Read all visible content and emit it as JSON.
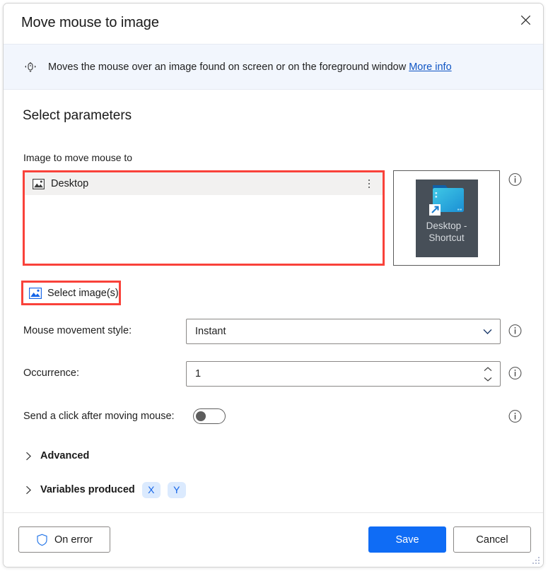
{
  "window": {
    "title": "Move mouse to image",
    "close_icon": "close-icon"
  },
  "banner": {
    "icon": "move-mouse-icon",
    "text": "Moves the mouse over an image found on screen or on the foreground window",
    "link_label": "More info"
  },
  "main": {
    "section_title": "Select parameters",
    "image_field_label": "Image to move mouse to",
    "image_list": {
      "items": [
        {
          "icon": "picture-icon",
          "label": "Desktop",
          "menu_icon": "more-vertical-icon"
        }
      ]
    },
    "preview": {
      "thumbnail_label_line1": "Desktop -",
      "thumbnail_label_line2": "Shortcut",
      "folder_icon": "folder-shortcut-icon",
      "info_icon": "info-icon"
    },
    "select_images_button": {
      "icon": "picture-icon",
      "label": "Select image(s)"
    },
    "fields": [
      {
        "label": "Mouse movement style:",
        "value": "Instant",
        "control": "dropdown",
        "control_icon": "chevron-down-icon",
        "info_icon": "info-icon"
      },
      {
        "label": "Occurrence:",
        "value": "1",
        "control": "spinner",
        "control_icon": "spinner-updown-icon",
        "info_icon": "info-icon"
      }
    ],
    "toggle_row": {
      "label": "Send a click after moving mouse:",
      "state": "off",
      "info_icon": "info-icon"
    },
    "sections": [
      {
        "label": "Advanced",
        "expanded": false,
        "chevron_icon": "chevron-right-icon",
        "chips": []
      },
      {
        "label": "Variables produced",
        "expanded": false,
        "chevron_icon": "chevron-right-icon",
        "chips": [
          "X",
          "Y"
        ]
      }
    ]
  },
  "footer": {
    "on_error_label": "On error",
    "on_error_icon": "shield-icon",
    "save_label": "Save",
    "cancel_label": "Cancel",
    "resize_grip_icon": "resize-grip-icon"
  },
  "colors": {
    "accent": "#0f6cf5",
    "highlight_box": "#f9423a",
    "banner_bg": "#f2f6fd",
    "link": "#0f55c4",
    "chip_bg": "#dbeafe",
    "chip_text": "#1565e8",
    "thumb_bg": "#474f58"
  }
}
